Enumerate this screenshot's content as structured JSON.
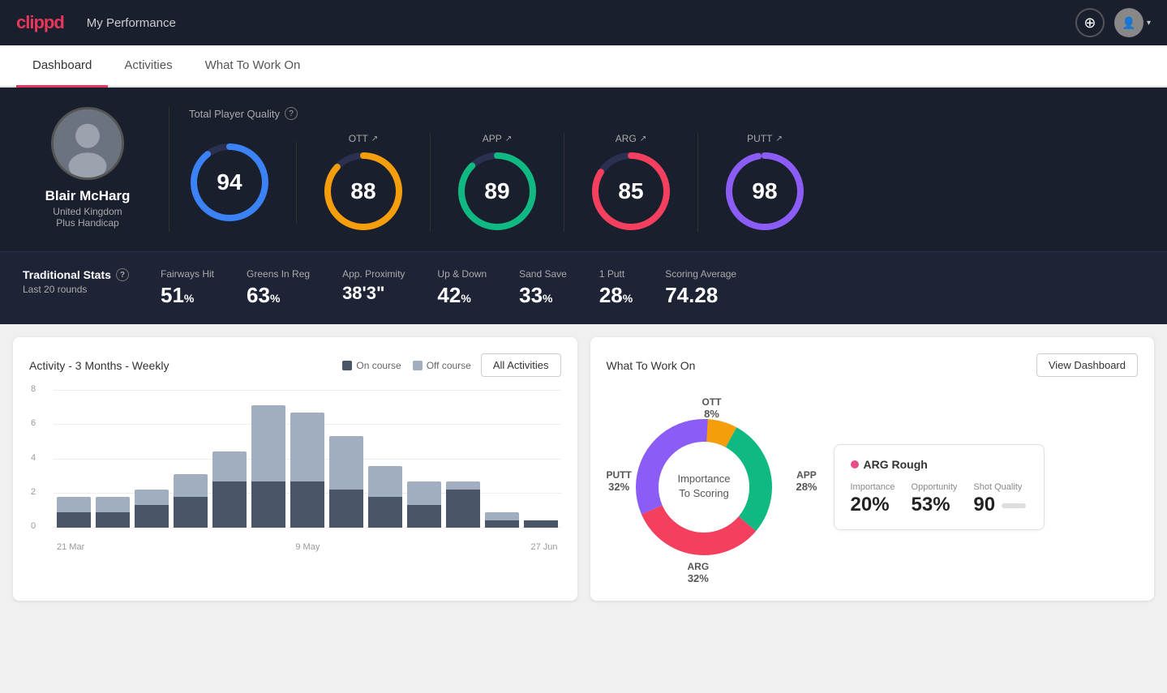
{
  "app": {
    "logo": "clippd",
    "nav_title": "My Performance"
  },
  "tabs": [
    {
      "id": "dashboard",
      "label": "Dashboard",
      "active": true
    },
    {
      "id": "activities",
      "label": "Activities",
      "active": false
    },
    {
      "id": "what-to-work-on",
      "label": "What To Work On",
      "active": false
    }
  ],
  "player": {
    "name": "Blair McHarg",
    "country": "United Kingdom",
    "handicap": "Plus Handicap"
  },
  "total_quality": {
    "title": "Total Player Quality",
    "score": 94,
    "color": "#3b82f6"
  },
  "category_scores": [
    {
      "label": "OTT",
      "value": 88,
      "color": "#f59e0b"
    },
    {
      "label": "APP",
      "value": 89,
      "color": "#10b981"
    },
    {
      "label": "ARG",
      "value": 85,
      "color": "#f43f5e"
    },
    {
      "label": "PUTT",
      "value": 98,
      "color": "#8b5cf6"
    }
  ],
  "traditional_stats": {
    "title": "Traditional Stats",
    "subtitle": "Last 20 rounds",
    "items": [
      {
        "name": "Fairways Hit",
        "value": "51",
        "unit": "%"
      },
      {
        "name": "Greens In Reg",
        "value": "63",
        "unit": "%"
      },
      {
        "name": "App. Proximity",
        "value": "38'3\"",
        "unit": ""
      },
      {
        "name": "Up & Down",
        "value": "42",
        "unit": "%"
      },
      {
        "name": "Sand Save",
        "value": "33",
        "unit": "%"
      },
      {
        "name": "1 Putt",
        "value": "28",
        "unit": "%"
      },
      {
        "name": "Scoring Average",
        "value": "74.28",
        "unit": ""
      }
    ]
  },
  "activity_chart": {
    "title": "Activity - 3 Months - Weekly",
    "legend": [
      {
        "label": "On course",
        "color": "#4a5568"
      },
      {
        "label": "Off course",
        "color": "#a0aec0"
      }
    ],
    "all_activities_label": "All Activities",
    "y_labels": [
      "8",
      "6",
      "4",
      "2",
      "0"
    ],
    "x_labels": [
      "21 Mar",
      "9 May",
      "27 Jun"
    ],
    "bars": [
      {
        "oncourse": 1,
        "offcourse": 1
      },
      {
        "oncourse": 1,
        "offcourse": 1
      },
      {
        "oncourse": 1.5,
        "offcourse": 1
      },
      {
        "oncourse": 2,
        "offcourse": 1.5
      },
      {
        "oncourse": 3,
        "offcourse": 2
      },
      {
        "oncourse": 3,
        "offcourse": 5
      },
      {
        "oncourse": 3,
        "offcourse": 4.5
      },
      {
        "oncourse": 2.5,
        "offcourse": 3.5
      },
      {
        "oncourse": 2,
        "offcourse": 2
      },
      {
        "oncourse": 1.5,
        "offcourse": 1.5
      },
      {
        "oncourse": 2.5,
        "offcourse": 0.5
      },
      {
        "oncourse": 0.5,
        "offcourse": 0.5
      },
      {
        "oncourse": 0.5,
        "offcourse": 0
      }
    ]
  },
  "what_to_work_on": {
    "title": "What To Work On",
    "view_dashboard_label": "View Dashboard",
    "donut": {
      "center_text": "Importance\nTo Scoring",
      "segments": [
        {
          "label": "OTT",
          "value": 8,
          "color": "#f59e0b",
          "position": {
            "top": "6%",
            "left": "50%"
          }
        },
        {
          "label": "APP",
          "value": 28,
          "color": "#10b981",
          "position": {
            "top": "50%",
            "right": "2%"
          }
        },
        {
          "label": "ARG",
          "value": 32,
          "color": "#f43f5e",
          "position": {
            "bottom": "5%",
            "left": "42%"
          }
        },
        {
          "label": "PUTT",
          "value": 32,
          "color": "#8b5cf6",
          "position": {
            "top": "42%",
            "left": "2%"
          }
        }
      ]
    },
    "detail": {
      "title": "ARG Rough",
      "dot_color": "#e74c8b",
      "metrics": [
        {
          "label": "Importance",
          "value": "20%"
        },
        {
          "label": "Opportunity",
          "value": "53%"
        },
        {
          "label": "Shot Quality",
          "value": "90"
        }
      ]
    }
  }
}
